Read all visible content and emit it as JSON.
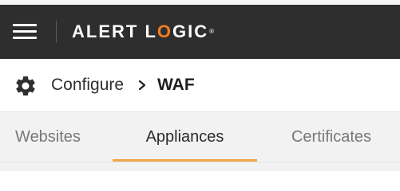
{
  "header": {
    "logo_part1": "ALERT L",
    "logo_accent": "O",
    "logo_part2": "GIC",
    "logo_mark": "®",
    "accent_color": "#f27d20",
    "background_color": "#2e2e2e"
  },
  "breadcrumb": {
    "icon": "gear-icon",
    "root_label": "Configure",
    "separator_icon": "chevron-right-icon",
    "current_label": "WAF"
  },
  "tabs": {
    "items": [
      {
        "label": "Websites",
        "active": false
      },
      {
        "label": "Appliances",
        "active": true
      },
      {
        "label": "Certificates",
        "active": false
      }
    ],
    "active_underline_color": "#f2a54a"
  }
}
